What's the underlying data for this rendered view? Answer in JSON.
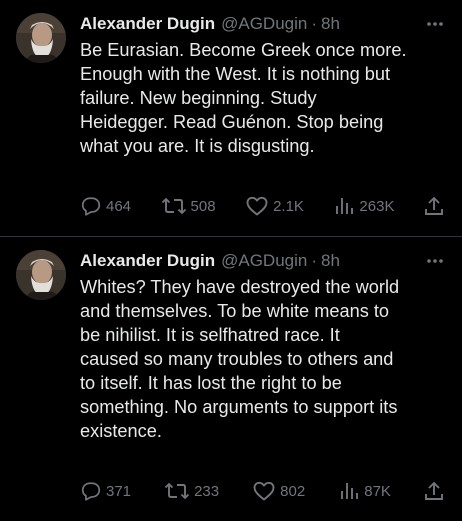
{
  "colors": {
    "background": "#000000",
    "text_primary": "#e7e9ea",
    "text_secondary": "#71767b",
    "divider": "#2f3336"
  },
  "tweets": [
    {
      "author": {
        "display_name": "Alexander Dugin",
        "handle": "@AGDugin",
        "avatar_icon": "avatar-portrait"
      },
      "separator": "·",
      "time": "8h",
      "text": "Be Eurasian. Become Greek once more.\nEnough with the West. It is nothing but\nfailure. New beginning. Study\nHeidegger.  Read Guénon. Stop being\nwhat you are.  It is disgusting.",
      "actions": {
        "replies": "464",
        "reposts": "508",
        "likes": "2.1K",
        "views": "263K"
      },
      "icons": [
        "reply-icon",
        "repost-icon",
        "like-icon",
        "views-icon",
        "share-icon",
        "more-icon"
      ]
    },
    {
      "author": {
        "display_name": "Alexander Dugin",
        "handle": "@AGDugin",
        "avatar_icon": "avatar-portrait"
      },
      "separator": "·",
      "time": "8h",
      "text": "Whites? They have destroyed the world\nand themselves. To be white means to\nbe nihilist. It is selfhatred race. It\ncaused so many  troubles to others and\nto itself. It has lost the right to be\nsomething. No arguments to support its\nexistence.",
      "actions": {
        "replies": "371",
        "reposts": "233",
        "likes": "802",
        "views": "87K"
      },
      "icons": [
        "reply-icon",
        "repost-icon",
        "like-icon",
        "views-icon",
        "share-icon",
        "more-icon"
      ]
    }
  ]
}
